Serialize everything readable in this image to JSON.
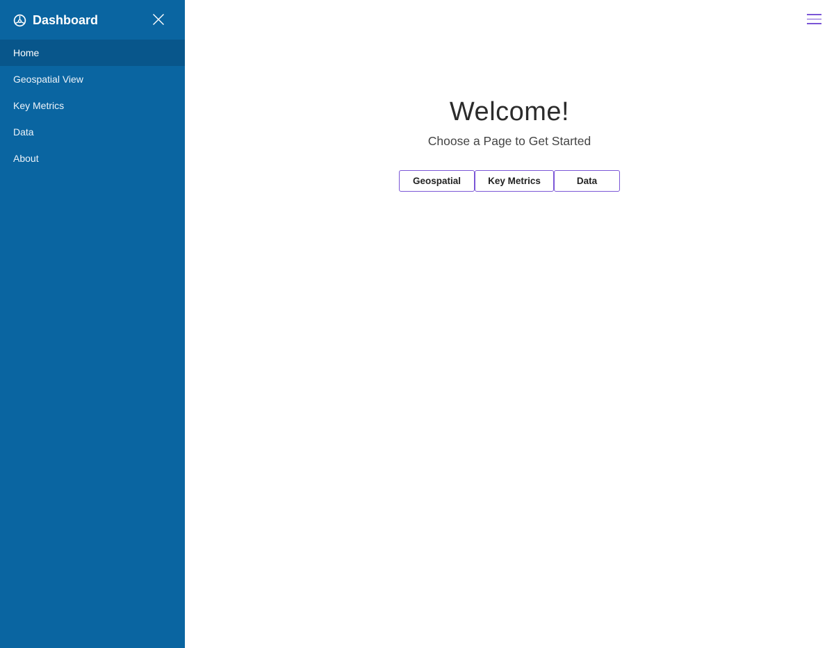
{
  "sidebar": {
    "title": "Dashboard",
    "brand_icon": "dashboard-gauge-icon",
    "close_icon": "close-icon",
    "background": "#0a65a1",
    "active_background": "#08568b",
    "items": [
      {
        "label": "Home",
        "active": true
      },
      {
        "label": "Geospatial View",
        "active": false
      },
      {
        "label": "Key Metrics",
        "active": false
      },
      {
        "label": "Data",
        "active": false
      },
      {
        "label": "About",
        "active": false
      }
    ]
  },
  "header": {
    "menu_icon": "hamburger-menu-icon",
    "accent": "#7a55d6"
  },
  "main": {
    "title": "Welcome!",
    "subtitle": "Choose a Page to Get Started",
    "buttons": [
      {
        "label": "Geospatial"
      },
      {
        "label": "Key Metrics"
      },
      {
        "label": "Data"
      }
    ]
  }
}
